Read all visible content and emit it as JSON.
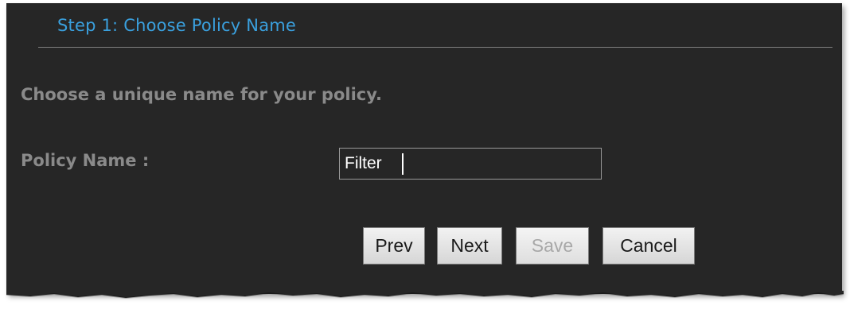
{
  "step": {
    "title": "Step 1: Choose Policy Name"
  },
  "content": {
    "instruction": "Choose a unique name for your policy.",
    "policy_name_label": "Policy Name :",
    "policy_name_value": "Filter"
  },
  "buttons": {
    "prev": "Prev",
    "next": "Next",
    "save": "Save",
    "cancel": "Cancel"
  },
  "colors": {
    "panel_background": "#262626",
    "title_blue": "#3aa0de",
    "label_gray": "#8a8a8a"
  }
}
